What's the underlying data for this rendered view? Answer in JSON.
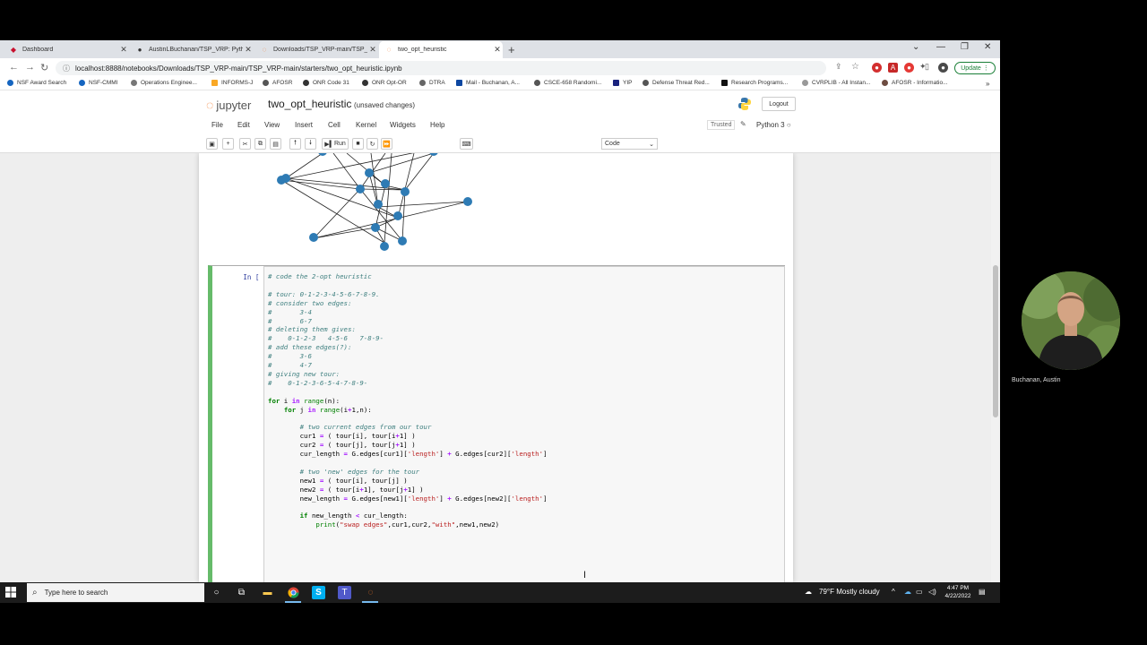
{
  "browser": {
    "tabs": [
      {
        "label": "Dashboard",
        "icon": "jupyter-icon"
      },
      {
        "label": "AustinLBuchanan/TSP_VRP: Pyth...",
        "icon": "github-icon"
      },
      {
        "label": "Downloads/TSP_VRP-main/TSP_...",
        "icon": "jupyter-icon"
      },
      {
        "label": "two_opt_heuristic",
        "icon": "jupyter-icon"
      }
    ],
    "url": "localhost:8888/notebooks/Downloads/TSP_VRP-main/TSP_VRP-main/starters/two_opt_heuristic.ipynb",
    "update_label": "Update",
    "bookmarks": [
      "NSF Award Search",
      "NSF-CMMI",
      "Operations Enginee...",
      "INFORMS-J",
      "AFOSR",
      "ONR Code 31",
      "ONR Opt-OR",
      "DTRA",
      "Mail - Buchanan, A...",
      "CSCE-658 Randomi...",
      "YIP",
      "Defense Threat Red...",
      "Research Programs...",
      "CVRPLIB - All Instan...",
      "AFOSR - Informatio..."
    ]
  },
  "jupyter": {
    "logo_text": "jupyter",
    "notebook_title": "two_opt_heuristic",
    "save_state": "(unsaved changes)",
    "logout_label": "Logout",
    "menu": [
      "File",
      "Edit",
      "View",
      "Insert",
      "Cell",
      "Kernel",
      "Widgets",
      "Help"
    ],
    "trusted_label": "Trusted",
    "kernel_label": "Python 3",
    "run_label": "Run",
    "cell_type": "Code"
  },
  "cell": {
    "prompt": "In [ ]:"
  },
  "taskbar": {
    "search_placeholder": "Type here to search",
    "weather": "79°F  Mostly cloudy",
    "time": "4:47 PM",
    "date": "4/22/2022"
  },
  "webcam": {
    "name": "Buchanan, Austin"
  },
  "colors": {
    "cell_selected": "#66bb6a",
    "node": "#2e7bb4",
    "jupyter_orange": "#f37626"
  }
}
